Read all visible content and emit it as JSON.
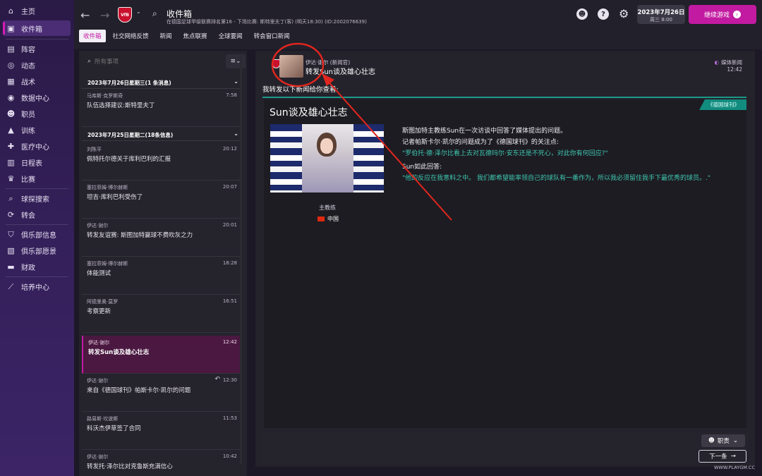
{
  "sidebar": {
    "items": [
      {
        "label": "主页",
        "icon": "home-icon",
        "glyph": "⌂"
      },
      {
        "label": "收件箱",
        "icon": "inbox-icon",
        "glyph": "▣",
        "active": true
      },
      {
        "label": "阵容",
        "icon": "shirt-icon",
        "glyph": "▤"
      },
      {
        "label": "动态",
        "icon": "pulse-icon",
        "glyph": "◎"
      },
      {
        "label": "战术",
        "icon": "tactics-icon",
        "glyph": "▦"
      },
      {
        "label": "数据中心",
        "icon": "data-icon",
        "glyph": "◉"
      },
      {
        "label": "职员",
        "icon": "staff-icon",
        "glyph": "☻"
      },
      {
        "label": "训练",
        "icon": "training-icon",
        "glyph": "▲"
      },
      {
        "label": "医疗中心",
        "icon": "medical-icon",
        "glyph": "✚"
      },
      {
        "label": "日程表",
        "icon": "calendar-icon",
        "glyph": "▥"
      },
      {
        "label": "比赛",
        "icon": "trophy-icon",
        "glyph": "♛"
      },
      {
        "label": "球探搜索",
        "icon": "scout-icon",
        "glyph": "⌕"
      },
      {
        "label": "转会",
        "icon": "transfer-icon",
        "glyph": "⟳"
      },
      {
        "label": "俱乐部信息",
        "icon": "shield-icon",
        "glyph": "⛉"
      },
      {
        "label": "俱乐部愿景",
        "icon": "vision-icon",
        "glyph": "▧"
      },
      {
        "label": "财政",
        "icon": "finance-icon",
        "glyph": "▬"
      },
      {
        "label": "培养中心",
        "icon": "development-icon",
        "glyph": "⟋"
      }
    ]
  },
  "header": {
    "back": "←",
    "forward": "→",
    "club_badge": "VfB",
    "title": "收件箱",
    "subtitle": "在德国足球甲级联赛排名第16 - 下场比赛: 斯特里夫丁(客) (明天18:30) (ID:2002076639)",
    "date": "2023年7月26日",
    "weekday_time": "周三 8:00",
    "continue_label": "继续游戏"
  },
  "tabs": [
    "收件箱",
    "社交网络反馈",
    "新闻",
    "焦点联赛",
    "全球要闻",
    "转会窗口新闻"
  ],
  "search": {
    "placeholder": "所有事项"
  },
  "groups": [
    {
      "label": "2023年7月26日星期三(1 条消息)"
    },
    {
      "label": "2023年7月25日星期二(18条信息)"
    }
  ],
  "messages": [
    {
      "from": "马库斯·克罗斯奇",
      "time": "7:58",
      "subject": "队伍选择建议:斯特里夫丁"
    },
    {
      "from": "刘陈平",
      "time": "20:12",
      "subject": "佩特托尔德关于库利巴利的汇报"
    },
    {
      "from": "塞拉菲姆·博尔赫斯",
      "time": "20:07",
      "subject": "坦吉·库利巴利受伤了"
    },
    {
      "from": "伊达·谢尔",
      "time": "20:01",
      "subject": "转发友谊赛: 斯图加特赢球不费吹灰之力"
    },
    {
      "from": "塞拉菲姆·博尔赫斯",
      "time": "18:28",
      "subject": "体能测试"
    },
    {
      "from": "阿德里奥·莫罗",
      "time": "16:51",
      "subject": "考察更新"
    },
    {
      "from": "伊达·谢尔",
      "time": "12:42",
      "subject": "转发Sun谈及雄心壮志",
      "selected": true
    },
    {
      "from": "伊达·谢尔",
      "time": "12:30",
      "subject": "来自《德国球刊》帕斯卡尔·凯尔的问题"
    },
    {
      "from": "路易斯·坎波斯",
      "time": "11:53",
      "subject": "科沃杰伊草签了合同"
    },
    {
      "from": "伊达·谢尔",
      "time": "10:42",
      "subject": "转发托·泽尔比对克鲁斯充满信心"
    }
  ],
  "detail": {
    "sender": "伊达·谢尔 (新闻官)",
    "subject": "转发Sun谈及雄心壮志",
    "media_tag": "媒体新闻",
    "time": "12:42",
    "forward_text": "我转发以下新闻给你查看:",
    "source": "《德国球刊》",
    "news_title": "Sun谈及雄心壮志",
    "role": "主教练",
    "nation": "中国",
    "lines": [
      {
        "text": "斯图加特主教练Sun在一次访谈中回答了媒体提出的问题。",
        "style": "white"
      },
      {
        "text": "记者帕斯卡尔·凯尔的问题成为了《德国球刊》的关注点:",
        "style": "white"
      },
      {
        "text": "\"罗伯托·德·泽尔比看上去对瓦德玛尔·安东还是不死心，对此你有何回应?\"",
        "style": "teal"
      },
      {
        "text": "Sun如此回答:",
        "style": "white"
      },
      {
        "text": "\"他的反应在我意料之中。 我们都希望能率领自己的球队有一番作为，所以我必须留住我手下最优秀的球员。.\"",
        "style": "teal"
      }
    ]
  },
  "bottom": {
    "duty_label": "职责",
    "next_label": "下一条",
    "watermark": "WWW.PLAYGM.CC"
  },
  "colors": {
    "accent": "#c21aa0",
    "teal": "#1a9a8a",
    "annotation": "#e0261f"
  }
}
